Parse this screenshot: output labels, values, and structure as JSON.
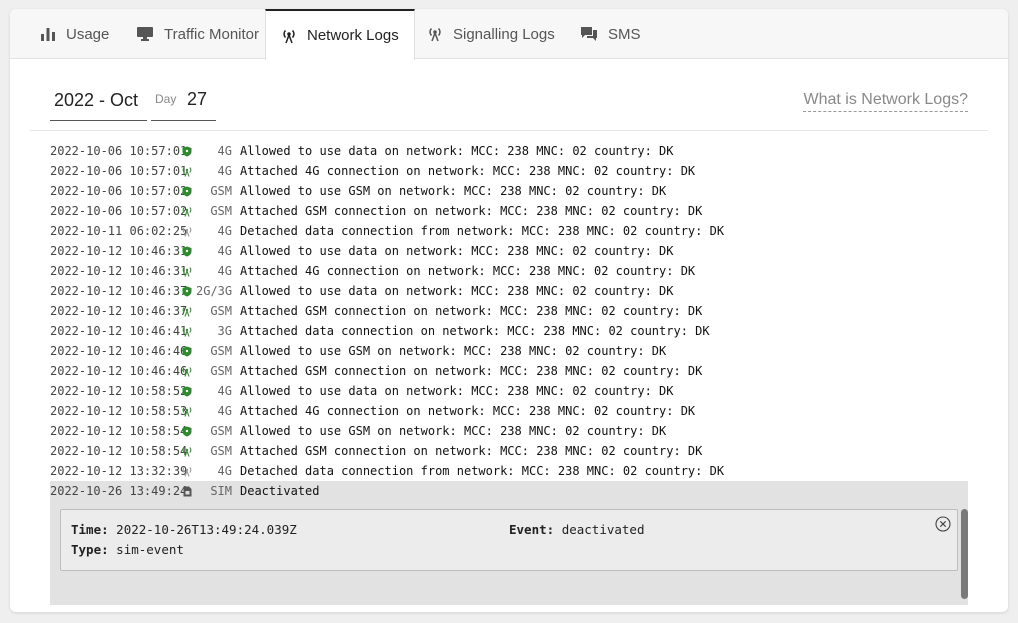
{
  "tabs": [
    {
      "label": "Usage",
      "icon": "bar-chart-icon",
      "active": false
    },
    {
      "label": "Traffic Monitor",
      "icon": "monitor-icon",
      "active": false
    },
    {
      "label": "Network Logs",
      "icon": "antenna-icon",
      "active": true
    },
    {
      "label": "Signalling Logs",
      "icon": "antenna-icon",
      "active": false
    },
    {
      "label": "SMS",
      "icon": "chat-icon",
      "active": false
    }
  ],
  "controls": {
    "month": "2022 - Oct",
    "day_label": "Day",
    "day": "27",
    "help_link": "What is Network Logs?"
  },
  "colors": {
    "shield": "#2e8b2e",
    "antenna_green": "#3a8f3a",
    "antenna_gray": "#9a9a9a",
    "sim": "#555555"
  },
  "log": [
    {
      "ts": "2022-10-06 10:57:01",
      "icon": "shield-icon",
      "net": "4G",
      "msg": "Allowed to use data on network: MCC: 238 MNC: 02 country: DK"
    },
    {
      "ts": "2022-10-06 10:57:01",
      "icon": "antenna-green-icon",
      "net": "4G",
      "msg": "Attached 4G connection on network: MCC: 238 MNC: 02 country: DK"
    },
    {
      "ts": "2022-10-06 10:57:02",
      "icon": "shield-icon",
      "net": "GSM",
      "msg": "Allowed to use GSM on network: MCC: 238 MNC: 02 country: DK"
    },
    {
      "ts": "2022-10-06 10:57:02",
      "icon": "antenna-green-icon",
      "net": "GSM",
      "msg": "Attached GSM connection on network: MCC: 238 MNC: 02 country: DK"
    },
    {
      "ts": "2022-10-11 06:02:25",
      "icon": "antenna-gray-icon",
      "net": "4G",
      "msg": "Detached data connection from network: MCC: 238 MNC: 02 country: DK"
    },
    {
      "ts": "2022-10-12 10:46:31",
      "icon": "shield-icon",
      "net": "4G",
      "msg": "Allowed to use data on network: MCC: 238 MNC: 02 country: DK"
    },
    {
      "ts": "2022-10-12 10:46:31",
      "icon": "antenna-green-icon",
      "net": "4G",
      "msg": "Attached 4G connection on network: MCC: 238 MNC: 02 country: DK"
    },
    {
      "ts": "2022-10-12 10:46:37",
      "icon": "shield-icon",
      "net": "2G/3G",
      "msg": "Allowed to use data on network: MCC: 238 MNC: 02 country: DK"
    },
    {
      "ts": "2022-10-12 10:46:37",
      "icon": "antenna-green-icon",
      "net": "GSM",
      "msg": "Attached GSM connection on network: MCC: 238 MNC: 02 country: DK"
    },
    {
      "ts": "2022-10-12 10:46:41",
      "icon": "antenna-green-icon",
      "net": "3G",
      "msg": "Attached data connection on network: MCC: 238 MNC: 02 country: DK"
    },
    {
      "ts": "2022-10-12 10:46:46",
      "icon": "shield-icon",
      "net": "GSM",
      "msg": "Allowed to use GSM on network: MCC: 238 MNC: 02 country: DK"
    },
    {
      "ts": "2022-10-12 10:46:46",
      "icon": "antenna-green-icon",
      "net": "GSM",
      "msg": "Attached GSM connection on network: MCC: 238 MNC: 02 country: DK"
    },
    {
      "ts": "2022-10-12 10:58:52",
      "icon": "shield-icon",
      "net": "4G",
      "msg": "Allowed to use data on network: MCC: 238 MNC: 02 country: DK"
    },
    {
      "ts": "2022-10-12 10:58:53",
      "icon": "antenna-green-icon",
      "net": "4G",
      "msg": "Attached 4G connection on network: MCC: 238 MNC: 02 country: DK"
    },
    {
      "ts": "2022-10-12 10:58:54",
      "icon": "shield-icon",
      "net": "GSM",
      "msg": "Allowed to use GSM on network: MCC: 238 MNC: 02 country: DK"
    },
    {
      "ts": "2022-10-12 10:58:54",
      "icon": "antenna-green-icon",
      "net": "GSM",
      "msg": "Attached GSM connection on network: MCC: 238 MNC: 02 country: DK"
    },
    {
      "ts": "2022-10-12 13:32:39",
      "icon": "antenna-gray-icon",
      "net": "4G",
      "msg": "Detached data connection from network: MCC: 238 MNC: 02 country: DK"
    }
  ],
  "selected": {
    "ts": "2022-10-26 13:49:24",
    "icon": "sim-card-icon",
    "net": "SIM",
    "msg": "Deactivated",
    "detail": {
      "time_key": "Time:",
      "time_value": "2022-10-26T13:49:24.039Z",
      "type_key": "Type:",
      "type_value": "sim-event",
      "event_key": "Event:",
      "event_value": "deactivated"
    }
  }
}
